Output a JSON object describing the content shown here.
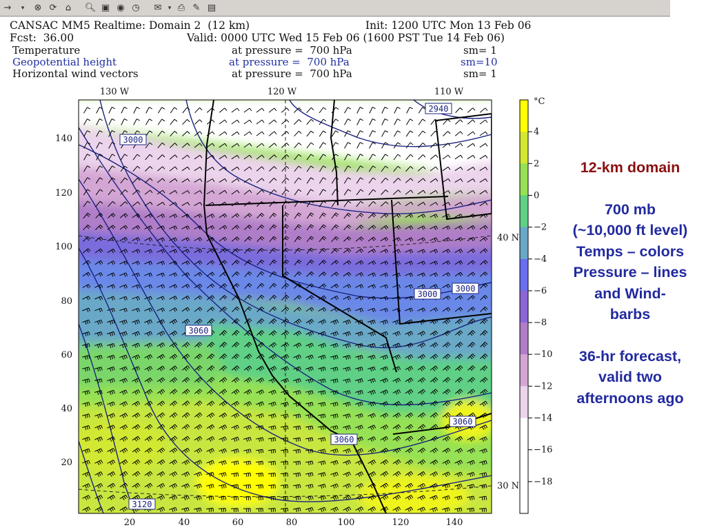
{
  "toolbar": {
    "icons": [
      "back-arrow-icon",
      "dropdown-icon",
      "stop-icon",
      "refresh-icon",
      "home-icon",
      "search-icon",
      "favorites-icon",
      "media-icon",
      "history-icon",
      "mail-icon",
      "print-icon",
      "edit-icon",
      "discuss-icon"
    ]
  },
  "header": {
    "line1_left": "CANSAC MM5 Realtime: Domain 2  (12 km)",
    "line1_right": "Init: 1200 UTC Mon 13 Feb 06",
    "line2_left": "Fcst:  36.00",
    "line2_right": "Valid: 0000 UTC Wed 15 Feb 06 (1600 PST Tue 14 Feb 06)",
    "fields": [
      {
        "name": "Temperature",
        "level": "at pressure =  700 hPa",
        "sm": "sm= 1"
      },
      {
        "name": "Geopotential height",
        "level": "at pressure =  700 hPa",
        "sm": "sm=10"
      },
      {
        "name": "Horizontal wind vectors",
        "level": "at pressure =  700 hPa",
        "sm": "sm= 1"
      }
    ]
  },
  "map": {
    "top_lon_labels": [
      "130 W",
      "120 W",
      "110 W"
    ],
    "left_ticks": [
      "140",
      "120",
      "100",
      "80",
      "60",
      "40",
      "20"
    ],
    "bottom_ticks": [
      "20",
      "40",
      "60",
      "80",
      "100",
      "120",
      "140"
    ],
    "lat_labels": [
      "40 N",
      "30 N"
    ],
    "contour_labels": [
      "3000",
      "2940",
      "3000",
      "3000",
      "3060",
      "3060",
      "3060",
      "3120"
    ]
  },
  "colorbar": {
    "unit": "°C",
    "labels": [
      "4",
      "2",
      "0",
      "−2",
      "−4",
      "−6",
      "−8",
      "−10",
      "−12",
      "−14",
      "−16",
      "−18"
    ],
    "colors": [
      "#ffff00",
      "#d2e830",
      "#96e155",
      "#5fd085",
      "#6aa8c8",
      "#6a6ef0",
      "#8a66d8",
      "#b07ec8",
      "#d4a6d4",
      "#ecd4ec",
      "#ffffff",
      "#ffffff",
      "#ffffff"
    ]
  },
  "side_text": {
    "title": "12-km domain",
    "block1": [
      "700 mb",
      "(~10,000 ft level)",
      "Temps – colors",
      "Pressure – lines",
      "and Wind-",
      "barbs"
    ],
    "block2": [
      "36-hr forecast,",
      "valid two",
      "afternoons ago"
    ]
  }
}
